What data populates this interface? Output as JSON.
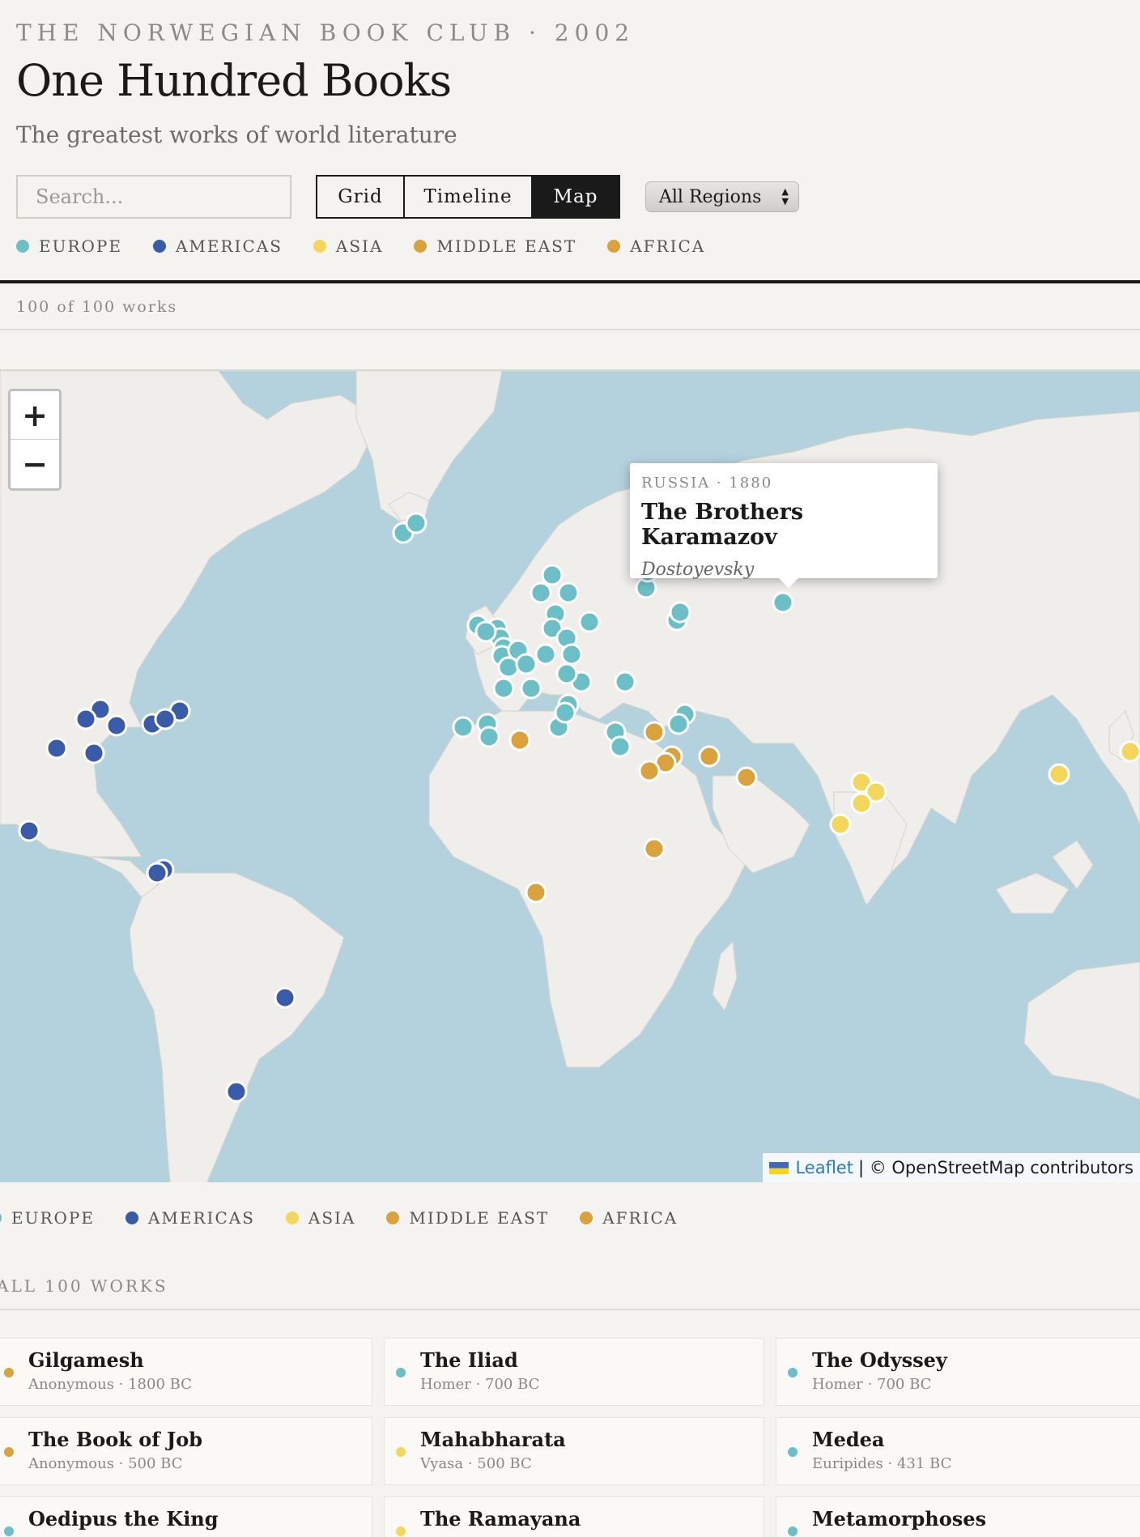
{
  "header": {
    "eyebrow": "THE NORWEGIAN BOOK CLUB · 2002",
    "title": "One Hundred Books",
    "subtitle": "The greatest works of world literature"
  },
  "controls": {
    "search_placeholder": "Search...",
    "views": [
      {
        "label": "Grid",
        "active": false
      },
      {
        "label": "Timeline",
        "active": false
      },
      {
        "label": "Map",
        "active": true
      }
    ],
    "region_select": "All Regions"
  },
  "legend": [
    {
      "label": "EUROPE",
      "color": "#6cbfc6"
    },
    {
      "label": "AMERICAS",
      "color": "#3a5ba8"
    },
    {
      "label": "ASIA",
      "color": "#f2d75c"
    },
    {
      "label": "MIDDLE EAST",
      "color": "#d9a23d"
    },
    {
      "label": "AFRICA",
      "color": "#d9a23d"
    }
  ],
  "count_text": "100 of 100 works",
  "map": {
    "zoom_in": "+",
    "zoom_out": "−",
    "popup": {
      "meta": "RUSSIA · 1880",
      "title": "The Brothers Karamazov",
      "author": "Dostoyevsky"
    },
    "attribution_leaflet": "Leaflet",
    "attribution_rest": "| © OpenStreetMap contributors"
  },
  "all_works_label": "ALL 100 WORKS",
  "works": [
    {
      "title": "Gilgamesh",
      "subtitle": "Anonymous · 1800 BC",
      "color": "#d9a23d"
    },
    {
      "title": "The Iliad",
      "subtitle": "Homer · 700 BC",
      "color": "#6cbfc6"
    },
    {
      "title": "The Odyssey",
      "subtitle": "Homer · 700 BC",
      "color": "#6cbfc6"
    },
    {
      "title": "The Book of Job",
      "subtitle": "Anonymous · 500 BC",
      "color": "#d9a23d"
    },
    {
      "title": "Mahabharata",
      "subtitle": "Vyasa · 500 BC",
      "color": "#f2d75c"
    },
    {
      "title": "Medea",
      "subtitle": "Euripides · 431 BC",
      "color": "#6cbfc6"
    },
    {
      "title": "Oedipus the King",
      "subtitle": "",
      "color": "#6cbfc6"
    },
    {
      "title": "The Ramayana",
      "subtitle": "",
      "color": "#f2d75c"
    },
    {
      "title": "Metamorphoses",
      "subtitle": "",
      "color": "#6cbfc6"
    }
  ]
}
